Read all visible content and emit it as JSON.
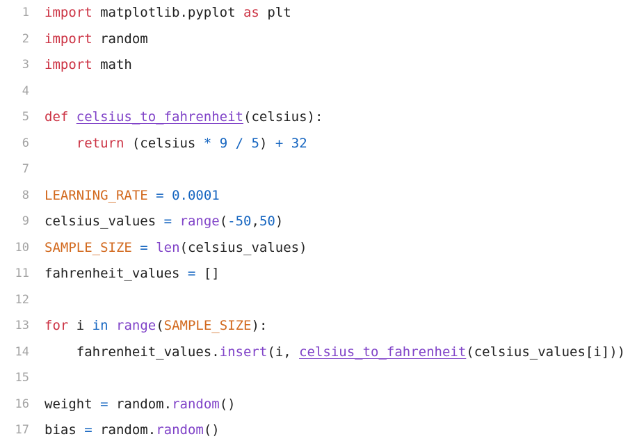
{
  "editor": {
    "language": "python",
    "background": "#ffffff",
    "gutter_color": "#a3a3a3",
    "text_color": "#222222",
    "colors": {
      "keyword": "#cc3344",
      "number": "#1565c0",
      "operator": "#1565c0",
      "builtin": "#8043c8",
      "constant": "#d2691e",
      "function": "#8043c8",
      "method": "#8043c8",
      "plain": "#222222"
    },
    "ghost_line_text": "import matplotlib.pyplot as plt",
    "lines": [
      {
        "number": "1",
        "text": "import matplotlib.pyplot as plt",
        "tokens": [
          {
            "t": "import",
            "c": "kw"
          },
          {
            "t": " matplotlib.pyplot ",
            "c": "plain"
          },
          {
            "t": "as",
            "c": "kw"
          },
          {
            "t": " plt",
            "c": "plain"
          }
        ]
      },
      {
        "number": "2",
        "text": "import random",
        "tokens": [
          {
            "t": "import",
            "c": "kw"
          },
          {
            "t": " random",
            "c": "plain"
          }
        ]
      },
      {
        "number": "3",
        "text": "import math",
        "tokens": [
          {
            "t": "import",
            "c": "kw"
          },
          {
            "t": " math",
            "c": "plain"
          }
        ]
      },
      {
        "number": "4",
        "text": "",
        "tokens": []
      },
      {
        "number": "5",
        "text": "def celsius_to_fahrenheit(celsius):",
        "tokens": [
          {
            "t": "def",
            "c": "kw"
          },
          {
            "t": " ",
            "c": "plain"
          },
          {
            "t": "celsius_to_fahrenheit",
            "c": "func"
          },
          {
            "t": "(celsius):",
            "c": "plain"
          }
        ]
      },
      {
        "number": "6",
        "text": "    return (celsius * 9 / 5) + 32",
        "tokens": [
          {
            "t": "    ",
            "c": "plain"
          },
          {
            "t": "return",
            "c": "kw"
          },
          {
            "t": " (celsius ",
            "c": "plain"
          },
          {
            "t": "*",
            "c": "op"
          },
          {
            "t": " ",
            "c": "plain"
          },
          {
            "t": "9",
            "c": "num"
          },
          {
            "t": " ",
            "c": "plain"
          },
          {
            "t": "/",
            "c": "op"
          },
          {
            "t": " ",
            "c": "plain"
          },
          {
            "t": "5",
            "c": "num"
          },
          {
            "t": ") ",
            "c": "plain"
          },
          {
            "t": "+",
            "c": "op"
          },
          {
            "t": " ",
            "c": "plain"
          },
          {
            "t": "32",
            "c": "num"
          }
        ]
      },
      {
        "number": "7",
        "text": "",
        "tokens": []
      },
      {
        "number": "8",
        "text": "LEARNING_RATE = 0.0001",
        "tokens": [
          {
            "t": "LEARNING_RATE",
            "c": "const"
          },
          {
            "t": " ",
            "c": "plain"
          },
          {
            "t": "=",
            "c": "op"
          },
          {
            "t": " ",
            "c": "plain"
          },
          {
            "t": "0.0001",
            "c": "num"
          }
        ]
      },
      {
        "number": "9",
        "text": "celsius_values = range(-50,50)",
        "tokens": [
          {
            "t": "celsius_values",
            "c": "plain"
          },
          {
            "t": " ",
            "c": "plain"
          },
          {
            "t": "=",
            "c": "op"
          },
          {
            "t": " ",
            "c": "plain"
          },
          {
            "t": "range",
            "c": "built"
          },
          {
            "t": "(",
            "c": "plain"
          },
          {
            "t": "-50",
            "c": "num"
          },
          {
            "t": ",",
            "c": "plain"
          },
          {
            "t": "50",
            "c": "num"
          },
          {
            "t": ")",
            "c": "plain"
          }
        ]
      },
      {
        "number": "10",
        "text": "SAMPLE_SIZE = len(celsius_values)",
        "tokens": [
          {
            "t": "SAMPLE_SIZE",
            "c": "const"
          },
          {
            "t": " ",
            "c": "plain"
          },
          {
            "t": "=",
            "c": "op"
          },
          {
            "t": " ",
            "c": "plain"
          },
          {
            "t": "len",
            "c": "built"
          },
          {
            "t": "(celsius_values)",
            "c": "plain"
          }
        ]
      },
      {
        "number": "11",
        "text": "fahrenheit_values = []",
        "tokens": [
          {
            "t": "fahrenheit_values",
            "c": "plain"
          },
          {
            "t": " ",
            "c": "plain"
          },
          {
            "t": "=",
            "c": "op"
          },
          {
            "t": " []",
            "c": "plain"
          }
        ]
      },
      {
        "number": "12",
        "text": "",
        "tokens": []
      },
      {
        "number": "13",
        "text": "for i in range(SAMPLE_SIZE):",
        "tokens": [
          {
            "t": "for",
            "c": "kw"
          },
          {
            "t": " i ",
            "c": "plain"
          },
          {
            "t": "in",
            "c": "op"
          },
          {
            "t": " ",
            "c": "plain"
          },
          {
            "t": "range",
            "c": "built"
          },
          {
            "t": "(",
            "c": "plain"
          },
          {
            "t": "SAMPLE_SIZE",
            "c": "const"
          },
          {
            "t": "):",
            "c": "plain"
          }
        ]
      },
      {
        "number": "14",
        "text": "    fahrenheit_values.insert(i, celsius_to_fahrenheit(celsius_values[i]))",
        "tokens": [
          {
            "t": "    fahrenheit_values.",
            "c": "plain"
          },
          {
            "t": "insert",
            "c": "meth"
          },
          {
            "t": "(i, ",
            "c": "plain"
          },
          {
            "t": "celsius_to_fahrenheit",
            "c": "func"
          },
          {
            "t": "(celsius_values[i]))",
            "c": "plain"
          }
        ]
      },
      {
        "number": "15",
        "text": "",
        "tokens": []
      },
      {
        "number": "16",
        "text": "weight = random.random()",
        "tokens": [
          {
            "t": "weight",
            "c": "plain"
          },
          {
            "t": " ",
            "c": "plain"
          },
          {
            "t": "=",
            "c": "op"
          },
          {
            "t": " random.",
            "c": "plain"
          },
          {
            "t": "random",
            "c": "meth"
          },
          {
            "t": "()",
            "c": "plain"
          }
        ]
      },
      {
        "number": "17",
        "text": "bias = random.random()",
        "tokens": [
          {
            "t": "bias",
            "c": "plain"
          },
          {
            "t": " ",
            "c": "plain"
          },
          {
            "t": "=",
            "c": "op"
          },
          {
            "t": " random.",
            "c": "plain"
          },
          {
            "t": "random",
            "c": "meth"
          },
          {
            "t": "()",
            "c": "plain"
          }
        ]
      }
    ]
  }
}
